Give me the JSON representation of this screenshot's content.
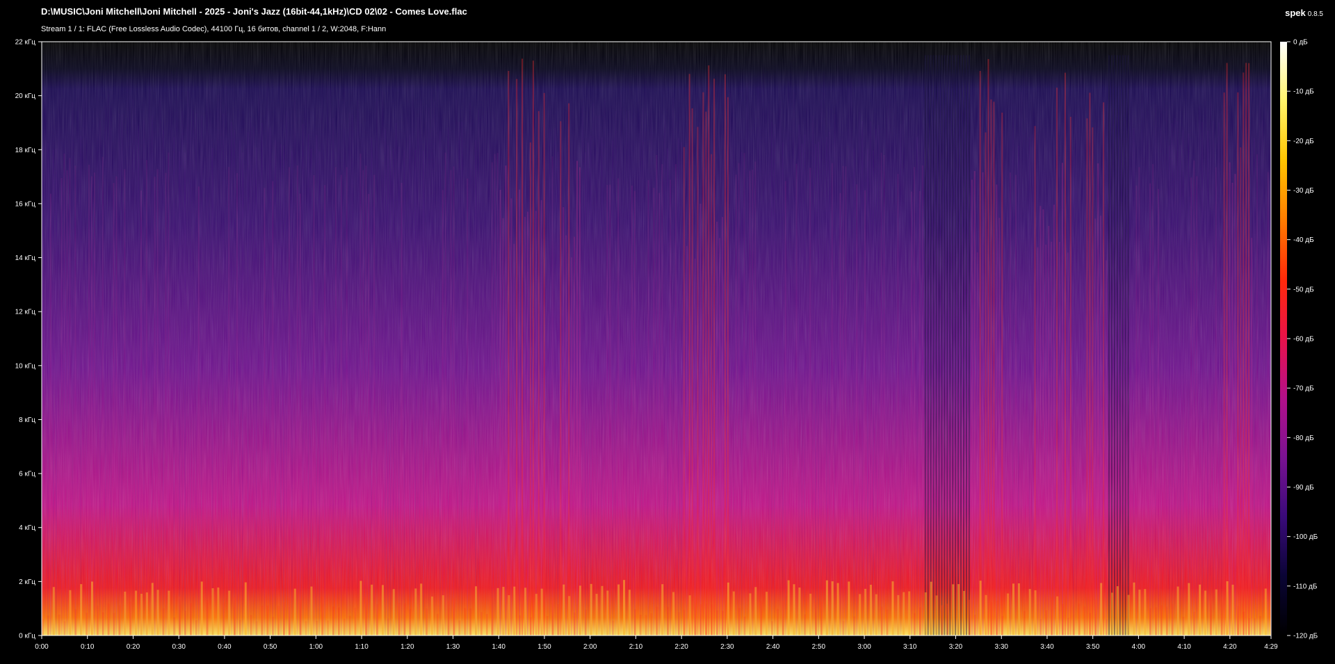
{
  "header": {
    "file_path": "D:\\MUSIC\\Joni Mitchell\\Joni Mitchell - 2025 - Joni's Jazz (16bit-44,1kHz)\\CD 02\\02 - Comes Love.flac",
    "stream_info": "Stream 1 / 1: FLAC (Free Lossless Audio Codec), 44100 Гц, 16 битов, channel 1 / 2, W:2048, F:Hann"
  },
  "app": {
    "name": "spek",
    "version": "0.8.5"
  },
  "colors": {
    "background": "#000000",
    "axis": "#ffffff",
    "text": "#ffffff"
  },
  "chart_data": {
    "type": "heatmap",
    "title": "",
    "freq_axis": {
      "unit": "кГц",
      "min": 0,
      "max": 22,
      "ticks": [
        0,
        2,
        4,
        6,
        8,
        10,
        12,
        14,
        16,
        18,
        20,
        22
      ],
      "tick_labels": [
        "0 кГц",
        "2 кГц",
        "4 кГц",
        "6 кГц",
        "8 кГц",
        "10 кГц",
        "12 кГц",
        "14 кГц",
        "16 кГц",
        "18 кГц",
        "20 кГц",
        "22 кГц"
      ]
    },
    "time_axis": {
      "min_seconds": 0,
      "max_seconds": 269,
      "tick_seconds": [
        0,
        10,
        20,
        30,
        40,
        50,
        60,
        70,
        80,
        90,
        100,
        110,
        120,
        130,
        140,
        150,
        160,
        170,
        180,
        190,
        200,
        210,
        220,
        230,
        240,
        250,
        260,
        269
      ],
      "tick_labels": [
        "0:00",
        "0:10",
        "0:20",
        "0:30",
        "0:40",
        "0:50",
        "1:00",
        "1:10",
        "1:20",
        "1:30",
        "1:40",
        "1:50",
        "2:00",
        "2:10",
        "2:20",
        "2:30",
        "2:40",
        "2:50",
        "3:00",
        "3:10",
        "3:20",
        "3:30",
        "3:40",
        "3:50",
        "4:00",
        "4:10",
        "4:20",
        "4:29"
      ]
    },
    "db_scale": {
      "min": -120,
      "max": 0,
      "ticks": [
        0,
        -10,
        -20,
        -30,
        -40,
        -50,
        -60,
        -70,
        -80,
        -90,
        -100,
        -110,
        -120
      ],
      "tick_labels": [
        "0 дБ",
        "-10 дБ",
        "-20 дБ",
        "-30 дБ",
        "-40 дБ",
        "-50 дБ",
        "-60 дБ",
        "-70 дБ",
        "-80 дБ",
        "-90 дБ",
        "-100 дБ",
        "-110 дБ",
        "-120 дБ"
      ],
      "palette": [
        "#000000",
        "#0a0435",
        "#3a0a7a",
        "#7a1292",
        "#b3108a",
        "#e8124a",
        "#ff2a0a",
        "#ff7c00",
        "#ffc400",
        "#fff36a",
        "#ffffff"
      ]
    },
    "content_cutoff_khz": 21.5,
    "loud_segments_seconds": [
      [
        100,
        110
      ],
      [
        113,
        118
      ],
      [
        140,
        150
      ],
      [
        200,
        210
      ],
      [
        217,
        225
      ],
      [
        228,
        235
      ],
      [
        258,
        265
      ]
    ],
    "quiet_segments_seconds": [
      [
        193,
        203
      ],
      [
        233,
        238
      ]
    ]
  }
}
